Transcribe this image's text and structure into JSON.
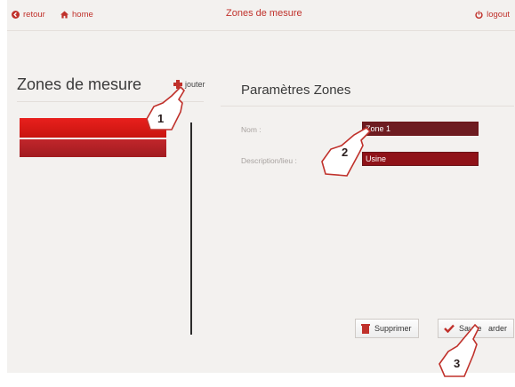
{
  "topbar": {
    "back_label": "retour",
    "home_label": "home",
    "title": "Zones de mesure",
    "logout_label": "logout"
  },
  "left_panel": {
    "title": "Zones de mesure",
    "add_label": "Ajouter",
    "add_label_visible": "jouter"
  },
  "right_panel": {
    "title": "Paramètres Zones",
    "nom_label": "Nom :",
    "nom_value": "Zone 1",
    "desc_label": "Description/lieu :",
    "desc_value": "Usine",
    "delete_label": "Supprimer",
    "save_label": "Sauvegarder",
    "save_label_visible": "Sauve   arder"
  },
  "callouts": [
    "1",
    "2",
    "3"
  ],
  "colors": {
    "accent": "#c0312b",
    "list_item_selected": "#e8201d",
    "list_item": "#b72126",
    "field_bg": "#6e1c21"
  },
  "icons": {
    "retour": "back-circle-icon",
    "home": "home-icon",
    "logout": "power-icon",
    "add": "plus-icon",
    "delete": "trash-icon",
    "save": "checkmark-icon"
  }
}
